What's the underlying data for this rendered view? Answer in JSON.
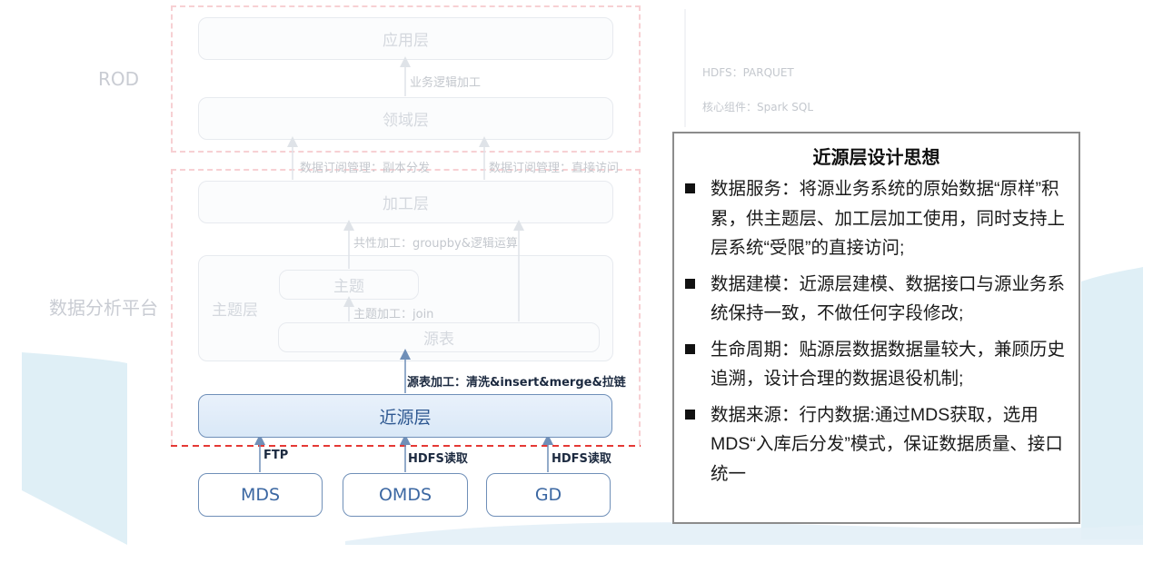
{
  "regions": {
    "rod": "ROD",
    "analysis_platform": "数据分析平台"
  },
  "side_notes": {
    "storage": "HDFS：PARQUET",
    "core_component": "核心组件：Spark SQL"
  },
  "layers": {
    "application": "应用层",
    "domain": "领域层",
    "processing": "加工层",
    "subject_layer": "主题层",
    "subject": "主题",
    "source_table": "源表",
    "near_source": "近源层"
  },
  "edge_labels": {
    "business_logic": "业务逻辑加工",
    "subscribe_copy": "数据订阅管理：副本分发",
    "subscribe_direct": "数据订阅管理：直接访问",
    "common_processing": "共性加工：groupby&逻辑运算",
    "subject_processing": "主题加工：join",
    "source_processing": "源表加工：清洗&insert&merge&拉链",
    "ftp": "FTP",
    "hdfs_read_1": "HDFS读取",
    "hdfs_read_2": "HDFS读取"
  },
  "sources": [
    "MDS",
    "OMDS",
    "GD"
  ],
  "panel": {
    "title": "近源层设计思想",
    "items": [
      "数据服务：将源业务系统的原始数据“原样”积累，供主题层、加工层加工使用，同时支持上层系统“受限”的直接访问;",
      "数据建模：近源层建模、数据接口与源业务系统保持一致，不做任何字段修改;",
      "生命周期：贴源层数据数据量较大，兼顾历史追溯，设计合理的数据退役机制;",
      "数据来源：行内数据:通过MDS获取，选用MDS“入库后分发”模式，保证数据质量、接口统一"
    ]
  },
  "colors": {
    "accent_blue": "#6f8fb8",
    "dashed_red": "#e53935",
    "dashed_pink": "#f7d0d3",
    "wave_blue": "#dcedf5"
  }
}
